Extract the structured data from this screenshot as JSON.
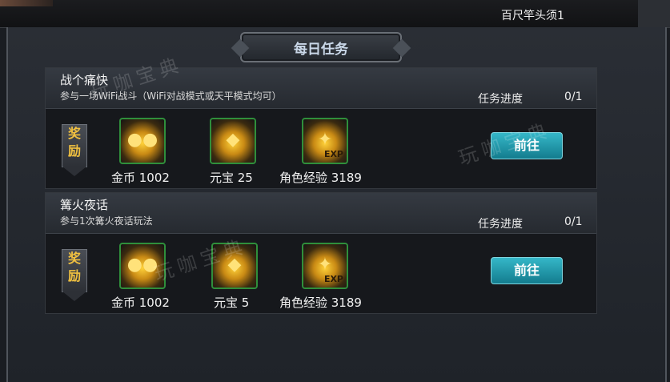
{
  "header": {
    "right_text": "百尺竿头须1"
  },
  "title": "每日任务",
  "progress_label": "任务进度",
  "reward_label": "奖励",
  "go_label": "前往",
  "watermark": "玩咖宝典",
  "tasks": [
    {
      "name": "战个痛快",
      "desc": "参与一场WiFi战斗（WiFi对战模式或天平模式均可）",
      "progress": "0/1",
      "rewards": [
        {
          "icon": "gold-coin-icon",
          "label": "金币 1002"
        },
        {
          "icon": "yuanbao-icon",
          "label": "元宝 25"
        },
        {
          "icon": "exp-icon",
          "label": "角色经验 3189"
        }
      ]
    },
    {
      "name": "篝火夜话",
      "desc": "参与1次篝火夜话玩法",
      "progress": "0/1",
      "rewards": [
        {
          "icon": "gold-coin-icon",
          "label": "金币 1002"
        },
        {
          "icon": "yuanbao-icon",
          "label": "元宝 5"
        },
        {
          "icon": "exp-icon",
          "label": "角色经验 3189"
        }
      ]
    }
  ],
  "colors": {
    "button": "#1f9fb2",
    "reward_text": "#f0c040",
    "item_border": "#2f8f3b"
  }
}
